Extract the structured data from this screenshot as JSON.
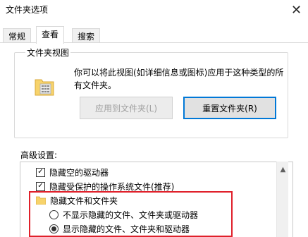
{
  "window": {
    "title": "文件夹选项",
    "close_glyph": "✕"
  },
  "tabs": [
    {
      "label": "常规",
      "active": false
    },
    {
      "label": "查看",
      "active": true
    },
    {
      "label": "搜索",
      "active": false
    }
  ],
  "folder_views": {
    "group_label": "文件夹视图",
    "description_line1": "你可以将此视图(如详细信息或图标)应用于这种类型的所",
    "description_line2": "有文件夹。",
    "apply_button": "应用到文件夹(L)",
    "reset_button": "重置文件夹(R)"
  },
  "advanced": {
    "label": "高级设置:",
    "items": [
      {
        "type": "checkbox",
        "label": "隐藏空的驱动器",
        "checked": true
      },
      {
        "type": "checkbox",
        "label": "隐藏受保护的操作系统文件(推荐)",
        "checked": true
      },
      {
        "type": "folder",
        "label": "隐藏文件和文件夹"
      },
      {
        "type": "radio",
        "label": "不显示隐藏的文件、文件夹或驱动器",
        "selected": false
      },
      {
        "type": "radio",
        "label": "显示隐藏的文件、文件夹和驱动器",
        "selected": true
      }
    ]
  },
  "colors": {
    "highlight": "#e0202a",
    "focus": "#0078d7",
    "folder": "#f7d36b"
  }
}
